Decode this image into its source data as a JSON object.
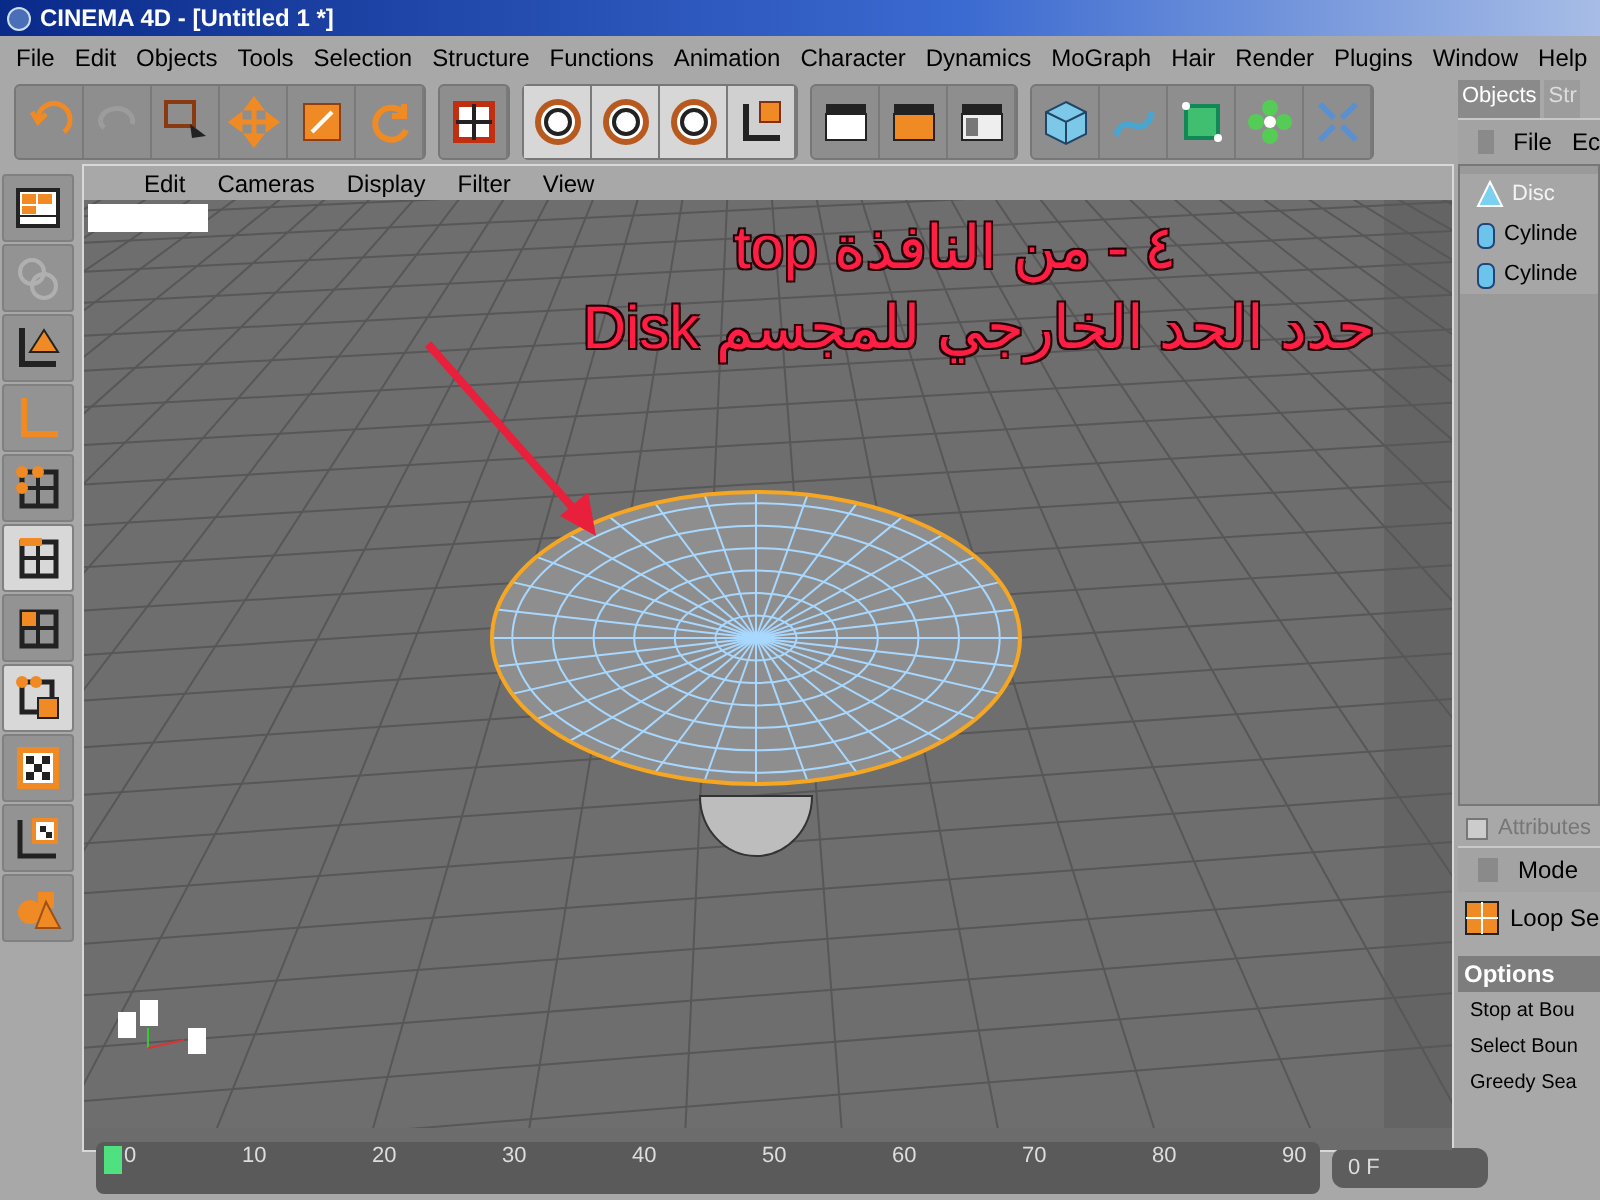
{
  "window": {
    "title": "CINEMA 4D - [Untitled 1 *]"
  },
  "menu": [
    "File",
    "Edit",
    "Objects",
    "Tools",
    "Selection",
    "Structure",
    "Functions",
    "Animation",
    "Character",
    "Dynamics",
    "MoGraph",
    "Hair",
    "Render",
    "Plugins",
    "Window",
    "Help"
  ],
  "left_tools": [
    {
      "kind": "layout",
      "selected": false
    },
    {
      "kind": "disabled",
      "selected": false
    },
    {
      "kind": "object-axis",
      "selected": false
    },
    {
      "kind": "model",
      "selected": false
    },
    {
      "kind": "points",
      "selected": false
    },
    {
      "kind": "edges",
      "selected": true
    },
    {
      "kind": "polygons",
      "selected": false
    },
    {
      "kind": "mixed",
      "selected": true
    },
    {
      "kind": "texture",
      "selected": false
    },
    {
      "kind": "texture-axis",
      "selected": false
    },
    {
      "kind": "primitives",
      "selected": false
    }
  ],
  "viewport": {
    "menu": [
      "Edit",
      "Cameras",
      "Display",
      "Filter",
      "View"
    ],
    "annotation": [
      "٤ - من النافذة top",
      "حدد الحد الخارجي للمجسم Disk"
    ]
  },
  "objects_panel": {
    "tabs": [
      {
        "label": "Objects",
        "selected": true
      },
      {
        "label": "Str",
        "selected": false
      }
    ],
    "menu": [
      "File",
      "Ec"
    ],
    "items": [
      {
        "name": "Disc",
        "kind": "disc"
      },
      {
        "name": "Cylinde",
        "kind": "cylinder"
      },
      {
        "name": "Cylinde",
        "kind": "cylinder"
      }
    ]
  },
  "attributes": {
    "title": "Attributes",
    "menu": [
      "Mode"
    ],
    "tool": "Loop Se",
    "section": "Options",
    "options": [
      "Stop at Bou",
      "Select Boun",
      "Greedy Sea"
    ]
  },
  "timeline": {
    "ticks": [
      "0",
      "10",
      "20",
      "30",
      "40",
      "50",
      "60",
      "70",
      "80",
      "90"
    ],
    "level": 0,
    "frame": "0 F"
  }
}
